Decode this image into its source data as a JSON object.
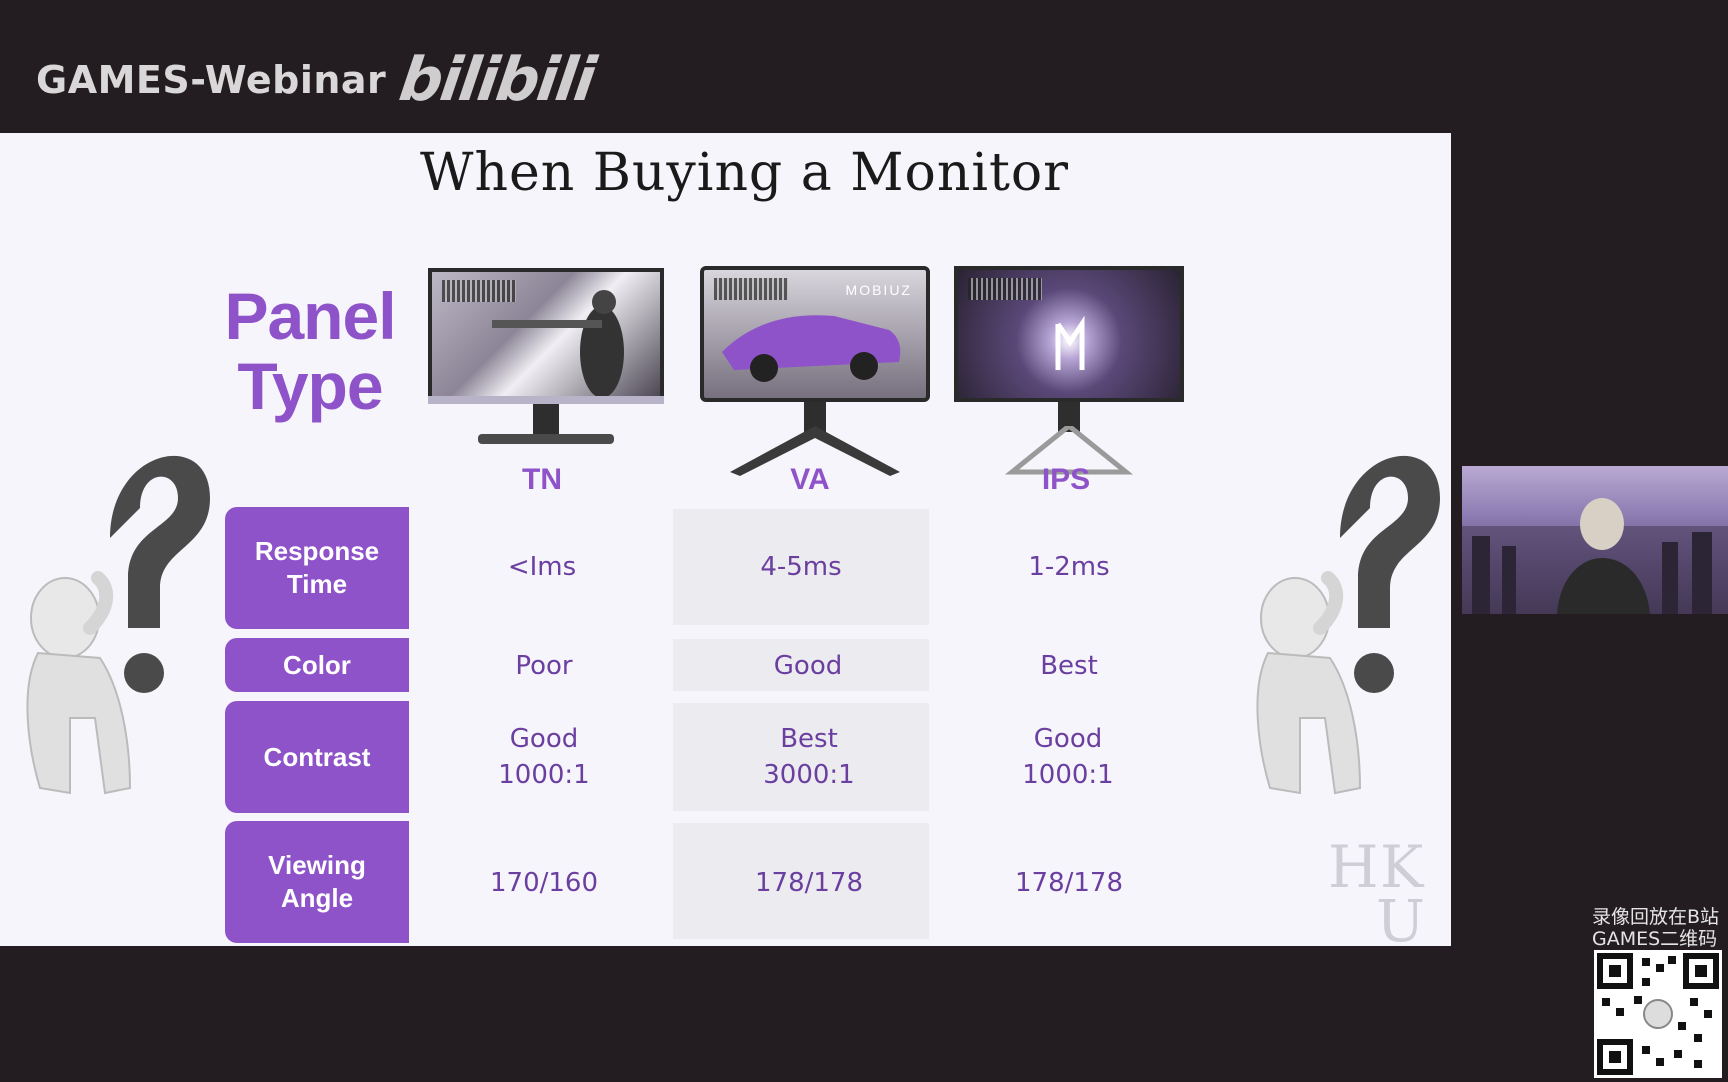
{
  "header": {
    "brand_text": "GAMES-Webinar",
    "logo_text": "bilibili"
  },
  "slide": {
    "title": "When Buying a Monitor",
    "heading_line1": "Panel",
    "heading_line2": "Type",
    "columns": [
      "TN",
      "VA",
      "IPS"
    ],
    "va_screen_label": "MOBIUZ",
    "rows": [
      {
        "label": "Response Time",
        "values": [
          "<Ims",
          "4-5ms",
          "1-2ms"
        ]
      },
      {
        "label": "Color",
        "values": [
          "Poor",
          "Good",
          "Best"
        ]
      },
      {
        "label": "Contrast",
        "values": [
          [
            "Good",
            "1000:1"
          ],
          [
            "Best",
            "3000:1"
          ],
          [
            "Good",
            "1000:1"
          ]
        ]
      },
      {
        "label": "Viewing Angle",
        "values": [
          "170/160",
          "178/178",
          "178/178"
        ]
      }
    ],
    "logo_letters": [
      "H",
      "K",
      "U"
    ],
    "accent_color": "#8e52c9"
  },
  "sidebar": {
    "qr_line1": "录像回放在B站",
    "qr_line2": "GAMES二维码"
  },
  "icons": {
    "question_figure": "thinking-person-question-mark-icon",
    "qr": "qr-code-icon"
  }
}
